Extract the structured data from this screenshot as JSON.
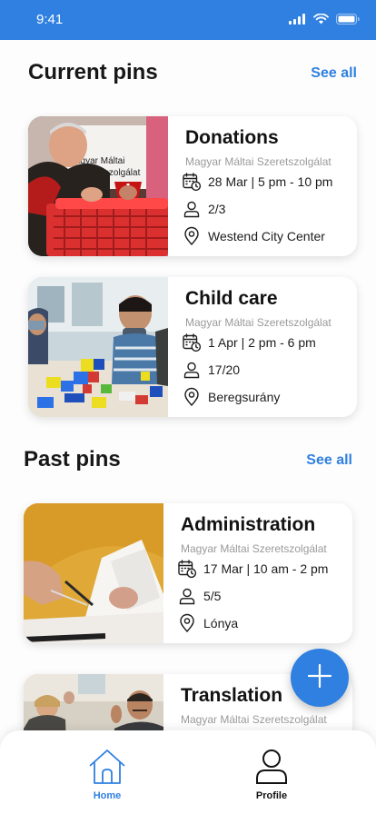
{
  "status_bar": {
    "time": "9:41"
  },
  "current_section": {
    "title": "Current pins",
    "see_all": "See all"
  },
  "past_section": {
    "title": "Past pins",
    "see_all": "See all"
  },
  "current_pins": [
    {
      "title": "Donations",
      "org": "Magyar Máltai Szeretszolgálat",
      "date": "28 Mar | 5 pm - 10 pm",
      "people": "2/3",
      "location": "Westend City Center"
    },
    {
      "title": "Child care",
      "org": "Magyar Máltai Szeretszolgálat",
      "date": "1 Apr | 2 pm - 6 pm",
      "people": "17/20",
      "location": "Beregsurány"
    }
  ],
  "past_pins": [
    {
      "title": "Administration",
      "org": "Magyar Máltai Szeretszolgálat",
      "date": "17 Mar | 10 am - 2 pm",
      "people": "5/5",
      "location": "Lónya"
    },
    {
      "title": "Translation",
      "org": "Magyar Máltai Szeretszolgálat"
    }
  ],
  "photo_sign_text": [
    "agyar Máltai",
    "Szeretszolgálat"
  ],
  "icons": {
    "status": [
      "signal-icon",
      "wifi-icon",
      "battery-icon"
    ],
    "rows": [
      "calendar-clock-icon",
      "person-icon",
      "location-pin-icon"
    ],
    "fab": "plus-icon",
    "nav": [
      "home-icon",
      "profile-icon"
    ]
  },
  "nav": {
    "home": "Home",
    "profile": "Profile"
  },
  "colors": {
    "accent": "#2f80e0",
    "text": "#121212",
    "muted": "#9a9a9a",
    "background": "#fdfdfd"
  }
}
